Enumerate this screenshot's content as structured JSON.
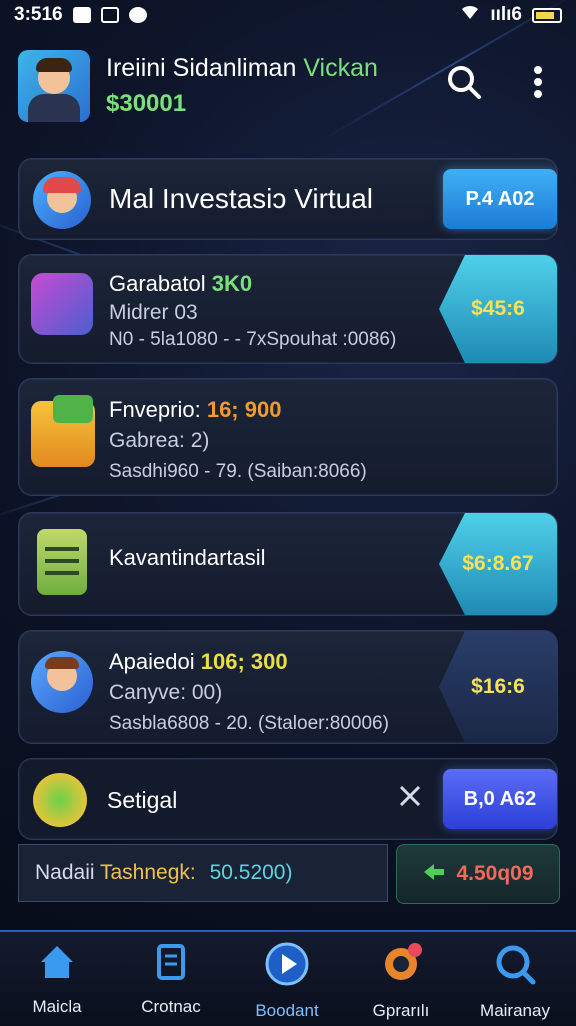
{
  "status_bar": {
    "time": "3:516",
    "signal_text": "ıılı6"
  },
  "header": {
    "title_main": "Ireiini Sidanliman ",
    "title_accent": "Vickan",
    "balance": "$30001"
  },
  "banner": {
    "title": "Mal Investasiↄ Virtual",
    "button_label": "P.4 A02"
  },
  "investments": [
    {
      "line1_main": "Garabatol ",
      "line1_accent": "3K0",
      "line2": "Midrer 03",
      "line3": "N0 - 5la1080 - - 7xSpouhat :0086)",
      "price": "$45:6"
    },
    {
      "line1_main": "Fnveprio: ",
      "line1_accent": "16; 900",
      "line2": "Gabrea: 2)",
      "line3": "Sasdhi960 - 79. (Saiban:8066)"
    },
    {
      "title": "Kavantindartasil",
      "price": "$6:8.67"
    },
    {
      "line1_main": "Apaiedoi ",
      "line1_accent": "106; 300",
      "line2": "Canyve: 00)",
      "line3": "Sasbla6808 - 20. (Staloer:80006)",
      "price": "$16:6"
    }
  ],
  "settings_row": {
    "label": "Setigal",
    "button_label": "B,0 A62"
  },
  "footer_row": {
    "label_main": "Nadaii ",
    "label_accent": "Tashnegk:",
    "value": "50.5200)",
    "button_label": "4.50q09"
  },
  "nav": {
    "items": [
      {
        "label": "Maicla"
      },
      {
        "label": "Crotnac"
      },
      {
        "label": "Boodant"
      },
      {
        "label": "Gprarılı"
      },
      {
        "label": "Mairanay"
      }
    ]
  },
  "colors": {
    "accent_green": "#79e07a",
    "accent_blue": "#3fb0f5",
    "price_yellow": "#f7e25a",
    "highlight_orange": "#f29a2e"
  }
}
